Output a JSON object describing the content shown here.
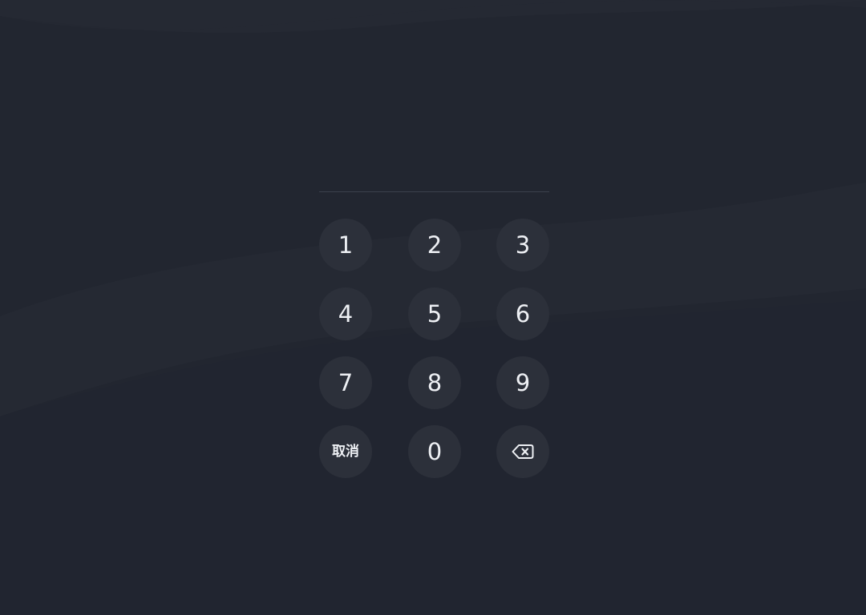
{
  "theme": {
    "background": "#222630",
    "key_background": "#2c303a",
    "key_text": "#eef0f4",
    "pin_line": "#3c414d"
  },
  "keypad": {
    "keys": [
      {
        "id": "1",
        "label": "1"
      },
      {
        "id": "2",
        "label": "2"
      },
      {
        "id": "3",
        "label": "3"
      },
      {
        "id": "4",
        "label": "4"
      },
      {
        "id": "5",
        "label": "5"
      },
      {
        "id": "6",
        "label": "6"
      },
      {
        "id": "7",
        "label": "7"
      },
      {
        "id": "8",
        "label": "8"
      },
      {
        "id": "9",
        "label": "9"
      },
      {
        "id": "cancel",
        "label": "取消"
      },
      {
        "id": "0",
        "label": "0"
      },
      {
        "id": "backspace",
        "icon": "backspace-icon"
      }
    ]
  }
}
